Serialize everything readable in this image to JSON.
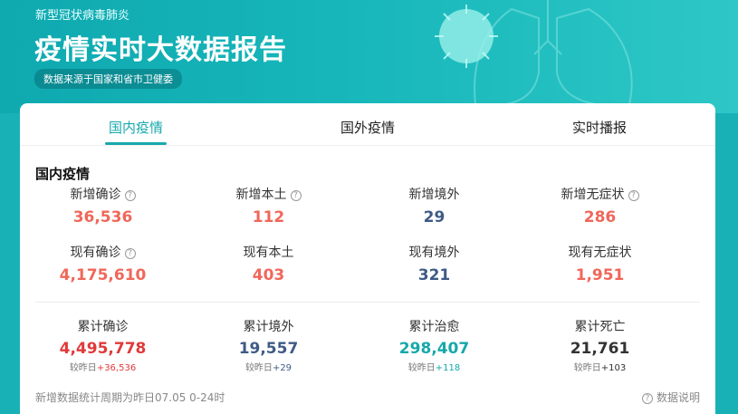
{
  "header": {
    "subtitle": "新型冠状病毒肺炎",
    "title": "疫情实时大数据报告",
    "source": "数据来源于国家和省市卫健委"
  },
  "tabs": [
    {
      "label": "国内疫情",
      "active": true
    },
    {
      "label": "国外疫情",
      "active": false
    },
    {
      "label": "实时播报",
      "active": false
    }
  ],
  "section_title": "国内疫情",
  "stats_row1": [
    {
      "label": "新增确诊",
      "value": "36,536",
      "help": true
    },
    {
      "label": "新增本土",
      "value": "112",
      "help": true
    },
    {
      "label": "新增境外",
      "value": "29",
      "help": false
    },
    {
      "label": "新增无症状",
      "value": "286",
      "help": true
    }
  ],
  "stats_row2": [
    {
      "label": "现有确诊",
      "value": "4,175,610",
      "help": true
    },
    {
      "label": "现有本土",
      "value": "403",
      "help": false
    },
    {
      "label": "现有境外",
      "value": "321",
      "help": false
    },
    {
      "label": "现有无症状",
      "value": "1,951",
      "help": false
    }
  ],
  "totals": [
    {
      "label": "累计确诊",
      "value": "4,495,778",
      "cmp_label": "较昨日",
      "cmp_value": "+36,536"
    },
    {
      "label": "累计境外",
      "value": "19,557",
      "cmp_label": "较昨日",
      "cmp_value": "+29"
    },
    {
      "label": "累计治愈",
      "value": "298,407",
      "cmp_label": "较昨日",
      "cmp_value": "+118"
    },
    {
      "label": "累计死亡",
      "value": "21,761",
      "cmp_label": "较昨日",
      "cmp_value": "+103"
    }
  ],
  "footer": {
    "note": "新增数据统计周期为昨日07.05 0-24时",
    "help_icon": "question-circle-icon",
    "link": "数据说明"
  },
  "colors": {
    "accent": "#18a9ad",
    "background": "#18b1b6",
    "red": "#f0675a",
    "blue": "#3e5b85"
  }
}
